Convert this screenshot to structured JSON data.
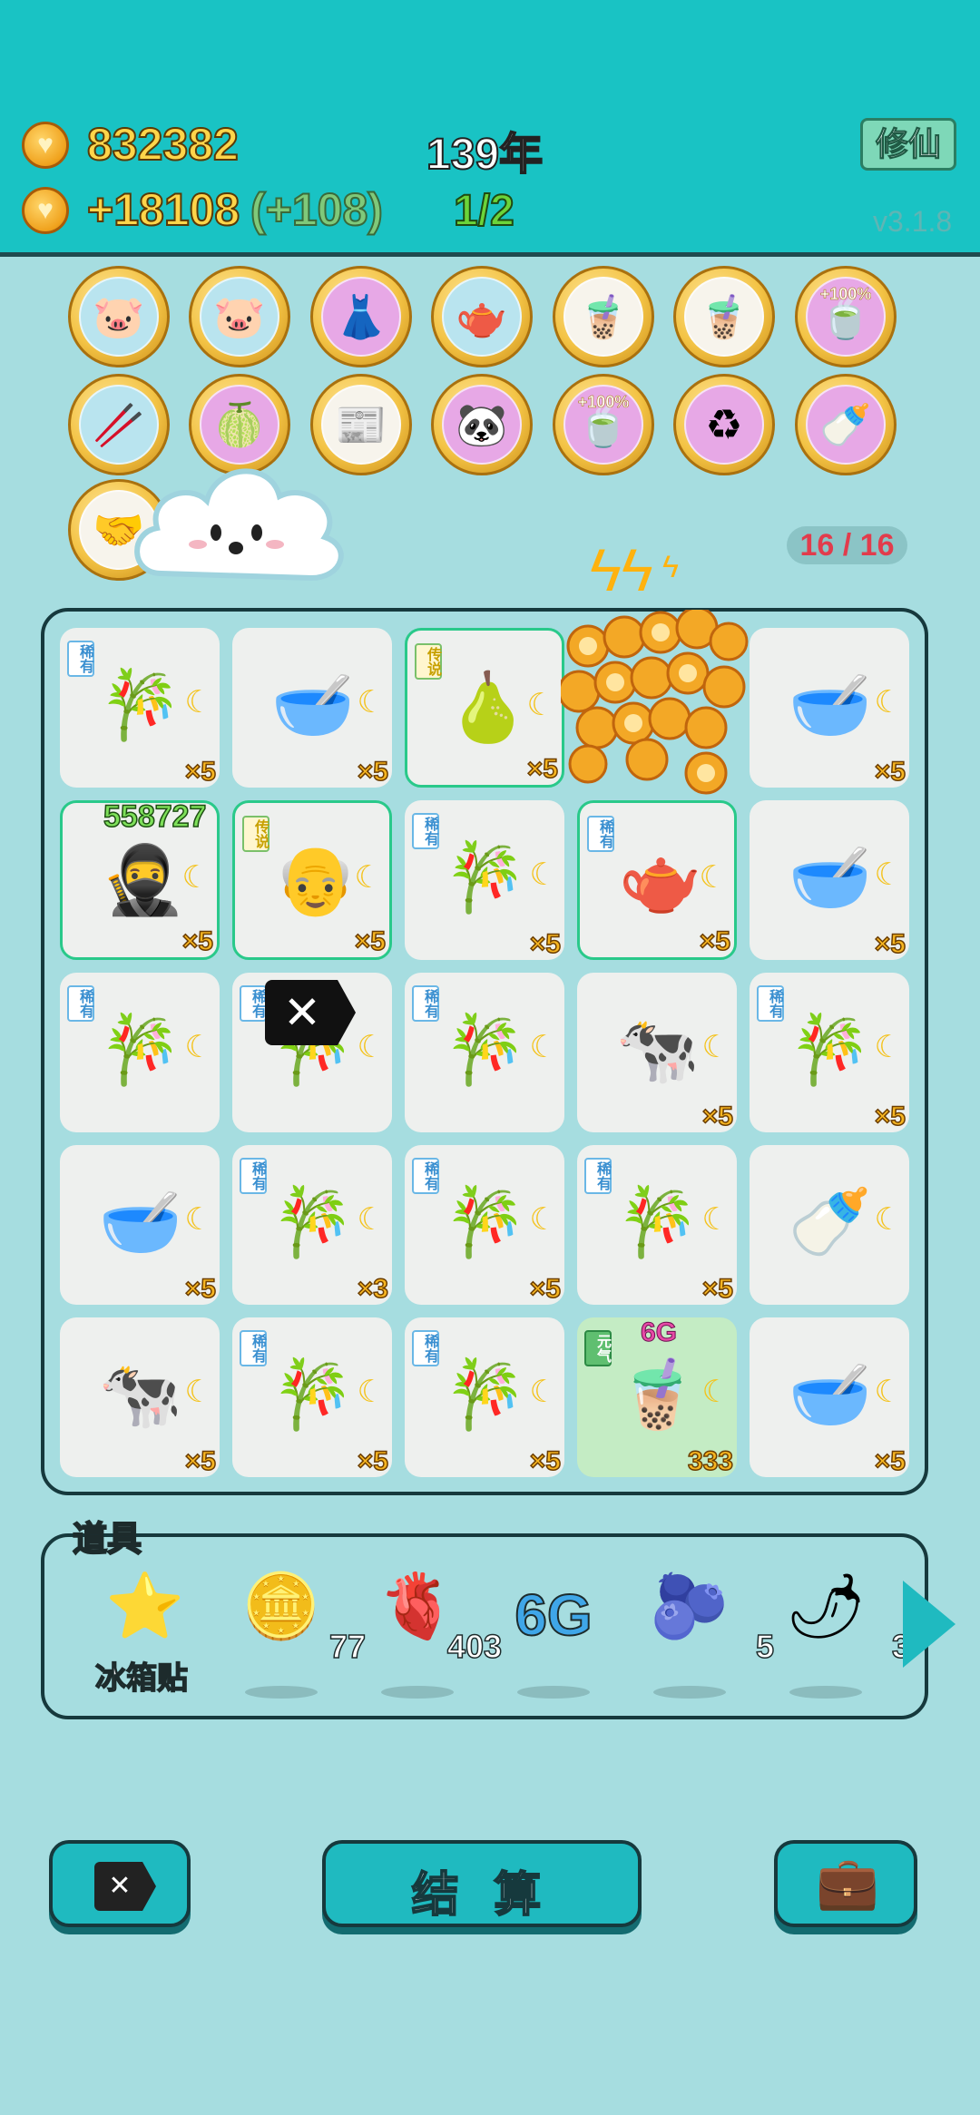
{
  "header": {
    "coins": "832382",
    "income": "+18108",
    "income_bonus": "(+108)",
    "year": "139年",
    "progress": "1/2",
    "xiuxian_label": "修仙",
    "version": "v3.1.8"
  },
  "badges": [
    {
      "icon": "piggy-bank-icon",
      "glyph": "🐷",
      "bg": "blue"
    },
    {
      "icon": "piggy-bank-icon",
      "glyph": "🐷",
      "bg": "blue"
    },
    {
      "icon": "skirt-icon",
      "glyph": "👗",
      "bg": "pink"
    },
    {
      "icon": "gravy-boat-icon",
      "glyph": "🫖",
      "bg": "blue"
    },
    {
      "icon": "bubble-tea-icon",
      "glyph": "🧋",
      "bg": "light"
    },
    {
      "icon": "bubble-tea-icon",
      "glyph": "🧋",
      "bg": "light"
    },
    {
      "icon": "tea-plus-icon",
      "glyph": "🍵",
      "bg": "pink",
      "pct": "+100%"
    },
    {
      "icon": "straws-icon",
      "glyph": "🥢",
      "bg": "blue"
    },
    {
      "icon": "pomelo-icon",
      "glyph": "🍈",
      "bg": "pink"
    },
    {
      "icon": "time-magazine-icon",
      "glyph": "📰",
      "bg": "light"
    },
    {
      "icon": "panda-icon",
      "glyph": "🐼",
      "bg": "pink"
    },
    {
      "icon": "tea-plus-icon",
      "glyph": "🍵",
      "bg": "pink",
      "pct": "+100%"
    },
    {
      "icon": "recycle-icon",
      "glyph": "♻",
      "bg": "pink"
    },
    {
      "icon": "breast-pump-icon",
      "glyph": "🍼",
      "bg": "pink"
    },
    {
      "icon": "handshake-icon",
      "glyph": "🤝",
      "bg": "light"
    }
  ],
  "energy_counter": "16 / 16",
  "board": [
    {
      "icon": "bamboo-icon",
      "glyph": "🎋",
      "tag": "稀有",
      "tag_type": "rare",
      "mult": "×5"
    },
    {
      "icon": "bowl-soup-icon",
      "glyph": "🥣",
      "mult": "×5"
    },
    {
      "icon": "pear-icon",
      "glyph": "🍐",
      "tag": "传说",
      "tag_type": "legend",
      "mult": "×5",
      "hl": true
    },
    {
      "icon": "coins-burst-icon",
      "glyph": "",
      "mult": ""
    },
    {
      "icon": "bowl-soup-icon",
      "glyph": "🥣",
      "mult": "×5"
    },
    {
      "icon": "thief-icon",
      "glyph": "🥷",
      "mult": "×5",
      "hl": true,
      "num": "558727"
    },
    {
      "icon": "grandpa-icon",
      "glyph": "👴",
      "tag": "传说",
      "tag_type": "legend",
      "mult": "×5",
      "hl": true
    },
    {
      "icon": "bamboo-icon",
      "glyph": "🎋",
      "tag": "稀有",
      "tag_type": "rare",
      "mult": "×5"
    },
    {
      "icon": "teapot-icon",
      "glyph": "🫖",
      "tag": "稀有",
      "tag_type": "rare",
      "mult": "×5",
      "hl": true
    },
    {
      "icon": "bowl-soup-icon",
      "glyph": "🥣",
      "mult": "×5"
    },
    {
      "icon": "bamboo-icon",
      "glyph": "🎋",
      "tag": "稀有",
      "tag_type": "rare",
      "mult": ""
    },
    {
      "icon": "bamboo-icon",
      "glyph": "🎋",
      "tag": "稀有",
      "tag_type": "rare",
      "mult": ""
    },
    {
      "icon": "bamboo-icon",
      "glyph": "🎋",
      "tag": "稀有",
      "tag_type": "rare",
      "mult": ""
    },
    {
      "icon": "cow-icon",
      "glyph": "🐄",
      "mult": "×5"
    },
    {
      "icon": "bamboo-icon",
      "glyph": "🎋",
      "tag": "稀有",
      "tag_type": "rare",
      "mult": "×5"
    },
    {
      "icon": "bowl-soup-icon",
      "glyph": "🥣",
      "mult": "×5"
    },
    {
      "icon": "bamboo-icon",
      "glyph": "🎋",
      "tag": "稀有",
      "tag_type": "rare",
      "mult": "×3"
    },
    {
      "icon": "bamboo-icon",
      "glyph": "🎋",
      "tag": "稀有",
      "tag_type": "rare",
      "mult": "×5"
    },
    {
      "icon": "bamboo-icon",
      "glyph": "🎋",
      "tag": "稀有",
      "tag_type": "rare",
      "mult": "×5"
    },
    {
      "icon": "milk-bottle-icon",
      "glyph": "🍼",
      "mult": ""
    },
    {
      "icon": "cow-icon",
      "glyph": "🐄",
      "mult": "×5"
    },
    {
      "icon": "bamboo-icon",
      "glyph": "🎋",
      "tag": "稀有",
      "tag_type": "rare",
      "mult": "×5"
    },
    {
      "icon": "bamboo-icon",
      "glyph": "🎋",
      "tag": "稀有",
      "tag_type": "rare",
      "mult": "×5"
    },
    {
      "icon": "bubble-tea-icon",
      "glyph": "🧋",
      "tag": "元气",
      "tag_type": "yuan",
      "mult": "333",
      "green": true,
      "top": "6G"
    },
    {
      "icon": "empty-bowl-icon",
      "glyph": "🥣",
      "mult": "×5"
    }
  ],
  "tools": {
    "label": "道具",
    "items": [
      {
        "icon": "star-icon",
        "glyph": "⭐",
        "label": "冰箱贴",
        "count": ""
      },
      {
        "icon": "dollar-coin-icon",
        "glyph": "🪙",
        "count": "77"
      },
      {
        "icon": "liver-icon",
        "glyph": "🫀",
        "count": "403"
      },
      {
        "icon": "6g-icon",
        "glyph": "6G",
        "count": ""
      },
      {
        "icon": "blueberry-icon",
        "glyph": "🫐",
        "count": "5"
      },
      {
        "icon": "chili-icon",
        "glyph": "🌶",
        "count": "3"
      }
    ]
  },
  "bottom": {
    "settle_label": "结 算"
  },
  "colors": {
    "topbar": "#19c3c4",
    "background": "#a6dde0",
    "accent_gold": "#ffd54a",
    "counter_red": "#e23c4c"
  }
}
